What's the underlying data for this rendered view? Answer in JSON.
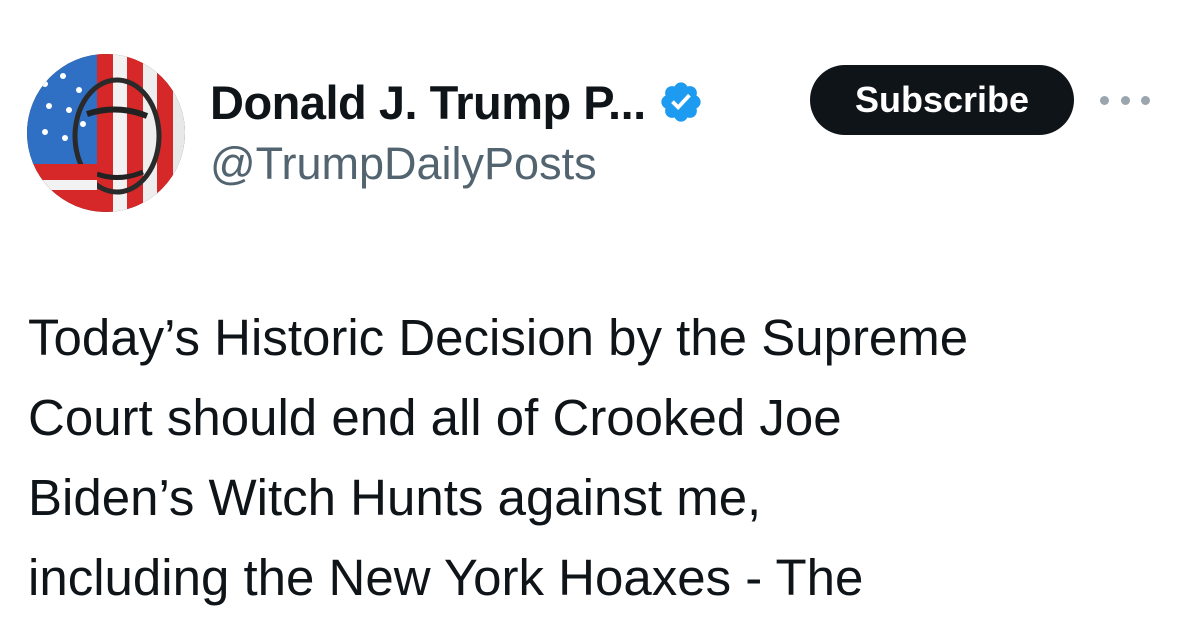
{
  "profile": {
    "display_name": "Donald J. Trump P...",
    "handle": "@TrumpDailyPosts",
    "verified": true,
    "avatar_icon": "flag-portrait-avatar"
  },
  "actions": {
    "subscribe_label": "Subscribe",
    "more_icon": "more-dots-icon"
  },
  "post": {
    "lines": [
      "Today’s Historic Decision by the Supreme",
      "Court should end all of Crooked Joe",
      "Biden’s Witch Hunts against me,",
      "including the New York Hoaxes - The"
    ]
  },
  "colors": {
    "text": "#0f1419",
    "secondary": "#536471",
    "verified_blue": "#1d9bf0",
    "button_bg": "#0f1419"
  }
}
